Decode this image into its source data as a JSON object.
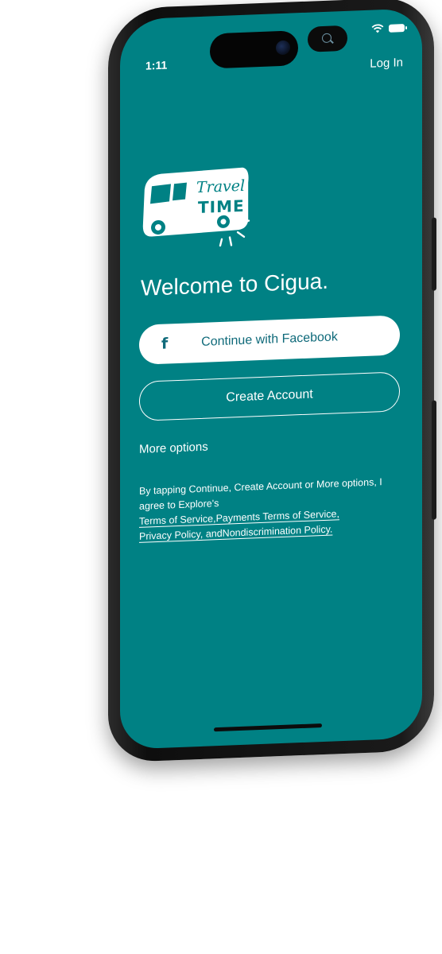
{
  "status_bar": {
    "time": "1:11"
  },
  "header": {
    "login_label": "Log In"
  },
  "logo": {
    "line1": "Travel",
    "line2": "TIME"
  },
  "welcome": {
    "title": "Welcome to Cigua."
  },
  "buttons": {
    "facebook_label": "Continue with Facebook",
    "facebook_icon": "facebook-icon",
    "create_account_label": "Create Account"
  },
  "more_options_label": "More options",
  "legal": {
    "intro": "By tapping Continue, Create Account or More options, I agree to Explore's",
    "terms_of_service": "Terms of Service,",
    "payments_terms": "Payments Terms of Service,",
    "privacy_policy": "Privacy Policy, and",
    "nondiscrimination_policy": "Nondiscrimination Policy."
  },
  "colors": {
    "screen_background": "#008184",
    "button_text": "#0f6a7a"
  }
}
